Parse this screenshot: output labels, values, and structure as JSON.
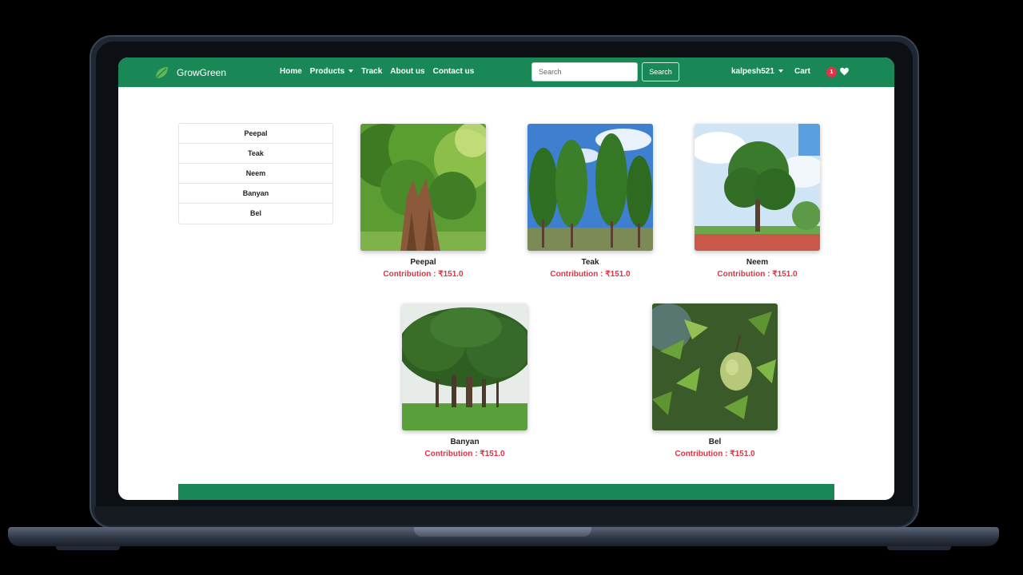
{
  "brand": {
    "name": "GrowGreen",
    "icon": "leaf-icon"
  },
  "nav": {
    "home": "Home",
    "products": "Products",
    "track": "Track",
    "about": "About us",
    "contact": "Contact us"
  },
  "search": {
    "placeholder": "Search",
    "button": "Search"
  },
  "user": {
    "name": "kalpesh521"
  },
  "cart": {
    "label": "Cart",
    "count": "1"
  },
  "sidebar": {
    "items": [
      {
        "label": "Peepal"
      },
      {
        "label": "Teak"
      },
      {
        "label": "Neem"
      },
      {
        "label": "Banyan"
      },
      {
        "label": "Bel"
      }
    ]
  },
  "products": [
    {
      "name": "Peepal",
      "price": "Contribution : ₹151.0"
    },
    {
      "name": "Teak",
      "price": "Contribution : ₹151.0"
    },
    {
      "name": "Neem",
      "price": "Contribution : ₹151.0"
    },
    {
      "name": "Banyan",
      "price": "Contribution : ₹151.0"
    },
    {
      "name": "Bel",
      "price": "Contribution : ₹151.0"
    }
  ],
  "colors": {
    "primary": "#1a8856",
    "price": "#dc3545",
    "badge": "#dc3545"
  }
}
